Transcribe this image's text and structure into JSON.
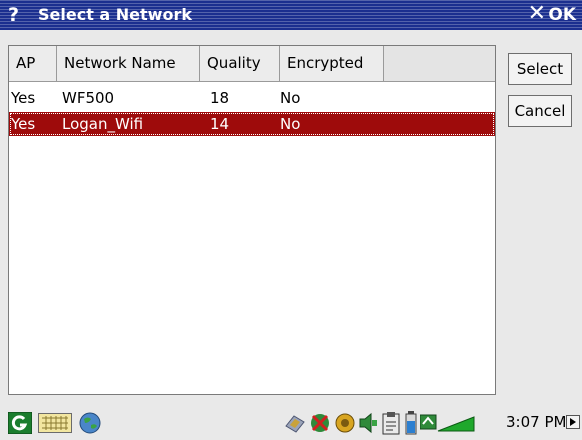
{
  "window": {
    "help_glyph": "?",
    "title": "Select a Network",
    "close_glyph": "✕",
    "ok_label": "OK"
  },
  "table": {
    "headers": [
      "AP",
      "Network Name",
      "Quality",
      "Encrypted"
    ],
    "rows": [
      {
        "ap": "Yes",
        "name": "WF500",
        "quality": "18",
        "encrypted": "No",
        "selected": false
      },
      {
        "ap": "Yes",
        "name": "Logan_Wifi",
        "quality": "14",
        "encrypted": "No",
        "selected": true
      }
    ]
  },
  "buttons": {
    "select": "Select",
    "cancel": "Cancel"
  },
  "taskbar": {
    "clock": "3:07 PM",
    "left_icons": [
      "start-icon",
      "keyboard-icon",
      "globe-icon"
    ],
    "tray_icons": [
      "network-icon",
      "security-icon",
      "sun-icon",
      "speaker-icon",
      "clipboard-icon",
      "battery-icon",
      "wifi-signal-icon",
      "arrow-right-icon"
    ]
  },
  "colors": {
    "titlebar": "#1b2f8f",
    "selection": "#9e0b0b",
    "background": "#e9e9e9"
  }
}
